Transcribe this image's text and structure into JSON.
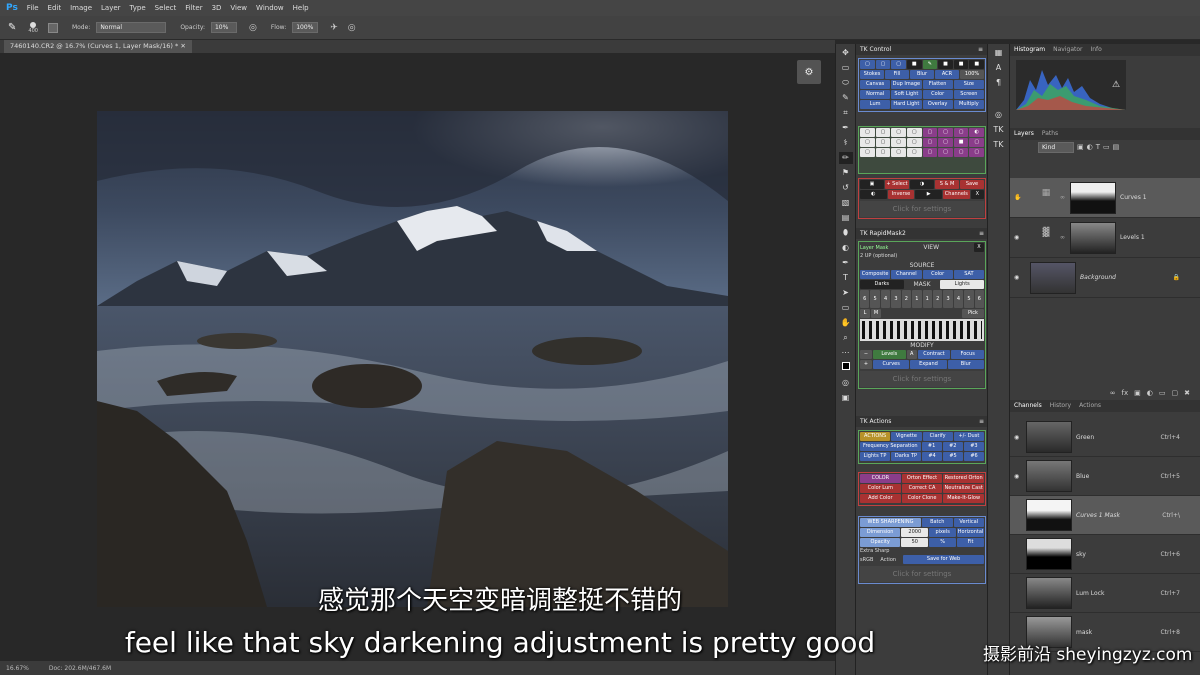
{
  "app": {
    "logo": "Ps"
  },
  "menu": [
    "File",
    "Edit",
    "Image",
    "Layer",
    "Type",
    "Select",
    "Filter",
    "3D",
    "View",
    "Window",
    "Help"
  ],
  "options": {
    "brush_size": "400",
    "mode_label": "Mode:",
    "mode_value": "Normal",
    "opacity_label": "Opacity:",
    "opacity_value": "10%",
    "flow_label": "Flow:",
    "flow_value": "100%"
  },
  "document": {
    "tab_title": "7460140.CR2 @ 16.7% (Curves 1, Layer Mask/16) *"
  },
  "status": {
    "zoom": "16.67%",
    "doc": "Doc: 202.6M/467.6M"
  },
  "tk_control": {
    "title": "TK Control",
    "row1": [
      "Stokes",
      "Fill",
      "Blur",
      "ACR",
      "100%"
    ],
    "row2": [
      "Canvas",
      "Dup Image",
      "Flatten",
      "Size"
    ],
    "row3": [
      "Normal",
      "Soft Light",
      "Color",
      "Screen"
    ],
    "row4": [
      "Lum",
      "Hard Light",
      "Overlay",
      "Multiply"
    ],
    "row5": [
      "+ Select",
      "S & M",
      "Save"
    ],
    "row6": [
      "Inverse",
      "Channels",
      "X"
    ],
    "click_settings": "Click for settings"
  },
  "tk_mask": {
    "title": "TK RapidMask2",
    "layer_mask": "Layer Mask",
    "view": "VIEW",
    "two_up": "2 UP (optional)",
    "source": "SOURCE",
    "source_btns": [
      "Composite",
      "Channel",
      "Color",
      "SAT"
    ],
    "mask": "MASK",
    "darks": "Darks",
    "lights": "Lights",
    "nums_dark": [
      "6",
      "5",
      "4",
      "3",
      "2",
      "1"
    ],
    "nums_light": [
      "1",
      "2",
      "3",
      "4",
      "5",
      "6"
    ],
    "lm": [
      "L",
      "M"
    ],
    "pick": "Pick",
    "modify": "MODIFY",
    "mod_row1": [
      "−",
      "Levels",
      "A",
      "Contract",
      "Focus"
    ],
    "mod_row2": [
      "+",
      "Curves",
      "Expand",
      "Blur"
    ],
    "click_settings": "Click for settings"
  },
  "tk_actions": {
    "title": "TK Actions",
    "actions_label": "ACTIONS",
    "actions_row1": [
      "Vignette",
      "Clarify",
      "+/- Dust"
    ],
    "actions_row2": [
      "Frequency Separation",
      "#1",
      "#2",
      "#3"
    ],
    "actions_row3": [
      "Lights TP",
      "Darks TP",
      "#4",
      "#5",
      "#6"
    ],
    "color_label": "COLOR",
    "color_row1": [
      "Orton Effect",
      "Restored Orton"
    ],
    "color_row2": [
      "Color Lum",
      "Correct CA",
      "Neutralize Cast"
    ],
    "color_row3": [
      "Add Color",
      "Color Clone",
      "Make-It-Glow"
    ],
    "web_label": "WEB SHARPENING",
    "web_row1": [
      "Batch",
      "Vertical"
    ],
    "dimension": "Dimension",
    "dimension_val": "2000",
    "pixels": "pixels",
    "horizontal": "Horizontal",
    "opacity": "Opacity",
    "opacity_val": "50",
    "pct": "%",
    "fit": "Fit",
    "extra_sharp": "Extra Sharp",
    "srgb": "sRGB",
    "action": "Action",
    "save_web": "Save for Web",
    "click_settings": "Click for settings"
  },
  "right": {
    "tabs_top": [
      "Histogram",
      "Navigator",
      "Info"
    ],
    "tabs_layers": [
      "Layers",
      "Paths"
    ],
    "kind": "Kind",
    "layers": [
      {
        "name": "Curves 1"
      },
      {
        "name": "Levels 1"
      },
      {
        "name": "Background"
      }
    ],
    "tabs_channels": [
      "Channels",
      "History",
      "Actions"
    ],
    "channels": [
      {
        "name": "Green",
        "short": "Ctrl+4"
      },
      {
        "name": "Blue",
        "short": "Ctrl+5"
      },
      {
        "name": "Curves 1 Mask",
        "short": "Ctrl+\\"
      },
      {
        "name": "sky",
        "short": "Ctrl+6"
      },
      {
        "name": "Lum Lock",
        "short": "Ctrl+7"
      },
      {
        "name": "mask",
        "short": "Ctrl+8"
      }
    ]
  },
  "subtitles": {
    "cn": "感觉那个天空变暗调整挺不错的",
    "en": "feel like that sky darkening adjustment is pretty good"
  },
  "watermark": "摄影前沿 sheyingzyz.com"
}
